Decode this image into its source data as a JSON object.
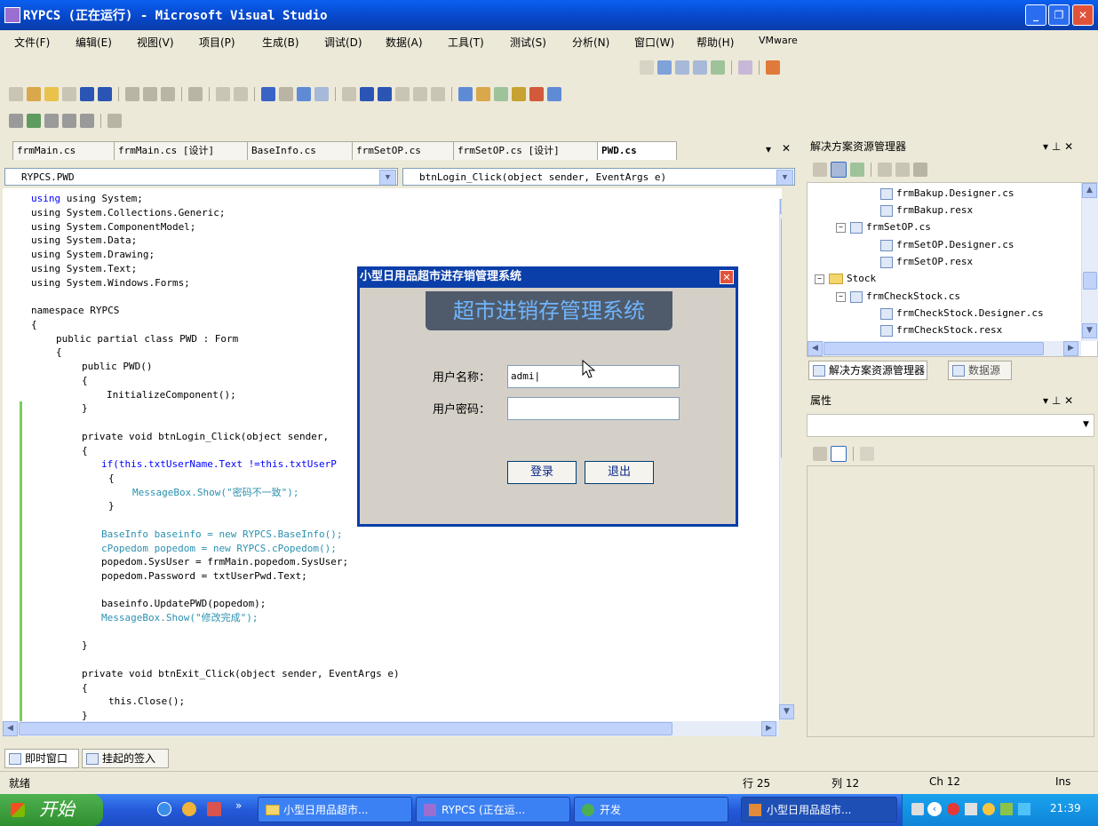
{
  "window": {
    "title": "RYPCS (正在运行) - Microsoft Visual Studio"
  },
  "menu": [
    "文件(F)",
    "编辑(E)",
    "视图(V)",
    "项目(P)",
    "生成(B)",
    "调试(D)",
    "数据(A)",
    "工具(T)",
    "测试(S)",
    "分析(N)",
    "窗口(W)",
    "帮助(H)",
    "VMware"
  ],
  "tabs": [
    "frmMain.cs",
    "frmMain.cs [设计]",
    "BaseInfo.cs",
    "frmSetOP.cs",
    "frmSetOP.cs [设计]",
    "PWD.cs"
  ],
  "editor": {
    "class_combo": "RYPCS.PWD",
    "member_combo": "btnLogin_Click(object sender, EventArgs e)"
  },
  "code": {
    "l1": "using System;",
    "l2": "using System.Collections.Generic;",
    "l3": "using System.ComponentModel;",
    "l4": "using System.Data;",
    "l5": "using System.Drawing;",
    "l6": "using System.Text;",
    "l7": "using System.Windows.Forms;",
    "l8": "namespace RYPCS",
    "l9": "{",
    "l10": "public partial class PWD : Form",
    "l11": "{",
    "l12": "public PWD()",
    "l13": "{",
    "l14": "InitializeComponent();",
    "l15": "}",
    "l16": "private void btnLogin_Click(object sender,",
    "l17": "{",
    "l18": "if(this.txtUserName.Text !=this.txtUserP",
    "l19": "{",
    "l20": "MessageBox.Show(\"密码不一致\");",
    "l21": "}",
    "l22": "BaseInfo baseinfo = new RYPCS.BaseInfo();",
    "l23": "cPopedom popedom = new RYPCS.cPopedom();",
    "l24": "popedom.SysUser = frmMain.popedom.SysUser;",
    "l25": "popedom.Password = txtUserPwd.Text;",
    "l26": "baseinfo.UpdatePWD(popedom);",
    "l27": "MessageBox.Show(\"修改完成\");",
    "l28": "}",
    "l29": "private void btnExit_Click(object sender, EventArgs e)",
    "l30": "{",
    "l31": "this.Close();",
    "l32": "}"
  },
  "solution_explorer": {
    "title": "解决方案资源管理器",
    "pin": "▾ ⊥ ✕",
    "items": [
      "frmBakup.Designer.cs",
      "frmBakup.resx",
      "frmSetOP.cs",
      "frmSetOP.Designer.cs",
      "frmSetOP.resx",
      "Stock",
      "frmCheckStock.cs",
      "frmCheckStock.Designer.cs",
      "frmCheckStock.resx"
    ],
    "bottom_tabs": [
      "解决方案资源管理器",
      "数据源"
    ]
  },
  "properties": {
    "title": "属性"
  },
  "dialog": {
    "title": "小型日用品超市进存销管理系统",
    "banner": "超市进销存管理系统",
    "username_label": "用户名称：",
    "username_value": "admi",
    "password_label": "用户密码：",
    "password_value": "",
    "login_btn": "登录",
    "exit_btn": "退出"
  },
  "bottom_tabs": [
    "即时窗口",
    "挂起的签入"
  ],
  "status": {
    "text": "就绪",
    "row": "行 25",
    "col": "列 12",
    "ch": "Ch 12",
    "ins": "Ins"
  },
  "taskbar": {
    "start": "开始",
    "tasks": [
      "小型日用品超市...",
      "RYPCS (正在运...",
      "开发",
      "小型日用品超市..."
    ],
    "clock": "21:39"
  },
  "colors": {
    "title_blue": "#0746c7",
    "taskbar_blue": "#2459d8",
    "start_green": "#2f8f2f",
    "keyword": "#0000ff",
    "type": "#2b91af",
    "string": "#a31515"
  }
}
